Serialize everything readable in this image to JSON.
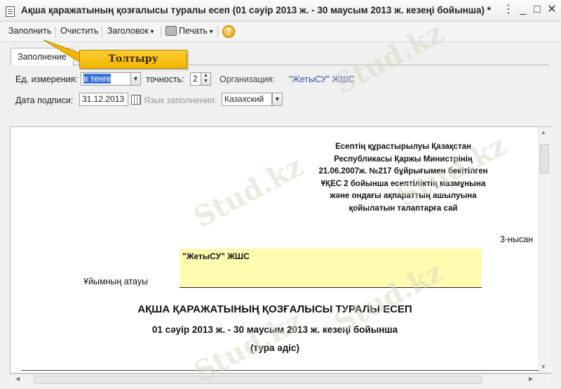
{
  "window": {
    "title": "Ақша қаражатының қозғалысы туралы есеп (01 сәуір 2013 ж. - 30 маусым 2013 ж. кезеңі бойынша) *",
    "controls": {
      "more": "⋮",
      "minimize": "_",
      "maximize": "□",
      "close": "✕"
    }
  },
  "toolbar": {
    "fill": "Заполнить",
    "clear": "Очистить",
    "header": "Заголовок",
    "print": "Печать",
    "help": "?"
  },
  "tabs": {
    "active": "Заполнение"
  },
  "callout": {
    "text": "Толтыру",
    "color": "#f2b400"
  },
  "form": {
    "units_label": "Ед. измерения:",
    "units_value": "в тенге",
    "precision_label": "точность:",
    "precision_value": "2",
    "org_label": "Организация:",
    "org_value": "\"ЖетыСУ\" ЖШС",
    "sign_date_label": "Дата подписи:",
    "sign_date_value": "31.12.2013",
    "language_label": "Язык заполнения:",
    "language_value": "Казахский"
  },
  "document": {
    "legal_note": [
      "Есептің құрастырылуы Қазақстан",
      "Республикасы Қаржы Министрінің",
      "21.06.2007ж. №217 бұйрығымен бекітілген",
      "ҰҚЕС 2 бойынша есептіліктің мазмұнына",
      "және ондағы ақпараттың ашылуына",
      "қойылатын талаптарға сай"
    ],
    "form_number": "3-нысан",
    "org_value": "\"ЖетыСУ\" ЖШС",
    "org_label": "Ұйымның атауы",
    "report_title": "АҚША ҚАРАЖАТЫНЫҢ ҚОЗҒАЛЫСЫ ТУРАЛЫ ЕСЕП",
    "period": "01 сәуір 2013 ж. - 30 маусым 2013 ж. кезеңі бойынша",
    "method": "(тура әдіс)"
  },
  "watermark": "Stud.kz"
}
